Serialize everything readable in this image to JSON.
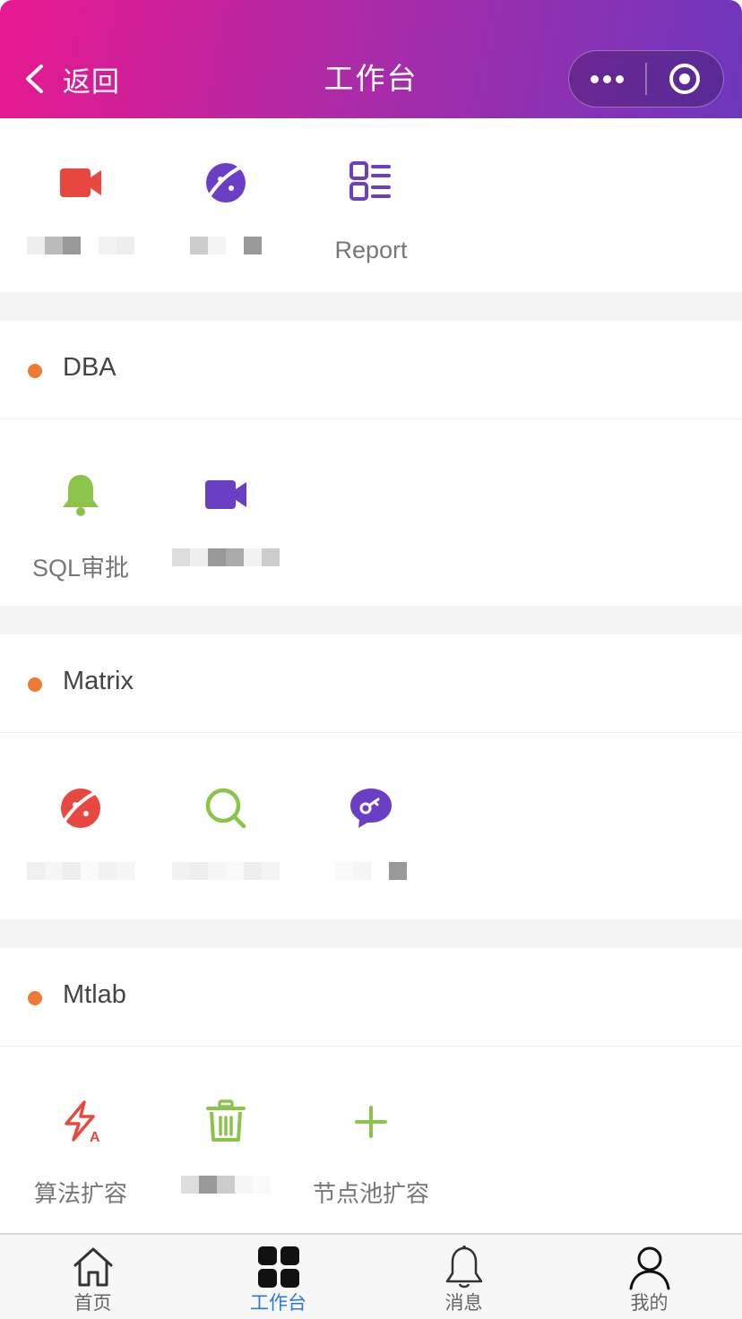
{
  "header": {
    "back_label": "返回",
    "title": "工作台",
    "menu_icon": "more-dots-icon",
    "close_icon": "target-circle-icon",
    "gradient": [
      "#e8188f",
      "#6d37bd"
    ]
  },
  "top_section": {
    "tiles": [
      {
        "icon": "video-camera-icon",
        "label": "",
        "color": "#e8483f"
      },
      {
        "icon": "planet-icon",
        "label": "",
        "color": "#6b3fc5"
      },
      {
        "icon": "report-list-icon",
        "label": "Report",
        "color": "#6b3fc5"
      }
    ]
  },
  "sections": [
    {
      "title": "DBA",
      "tiles": [
        {
          "icon": "bell-icon",
          "label": "SQL审批",
          "color": "#8cc34a"
        },
        {
          "icon": "video-camera-icon",
          "label": "",
          "color": "#6b3fc5"
        }
      ]
    },
    {
      "title": "Matrix",
      "tiles": [
        {
          "icon": "planet-icon",
          "label": "",
          "color": "#e8483f"
        },
        {
          "icon": "search-icon",
          "label": "",
          "color": "#8cc34a"
        },
        {
          "icon": "chat-key-icon",
          "label": "",
          "color": "#6b3fc5"
        }
      ]
    },
    {
      "title": "Mtlab",
      "tiles": [
        {
          "icon": "flash-a-icon",
          "label": "算法扩容",
          "color": "#e8483f"
        },
        {
          "icon": "trash-icon",
          "label": "",
          "color": "#8cc34a"
        },
        {
          "icon": "plus-icon",
          "label": "节点池扩容",
          "color": "#8cc34a"
        }
      ]
    }
  ],
  "tabbar": {
    "tabs": [
      {
        "label": "首页",
        "icon": "home-icon",
        "active": false
      },
      {
        "label": "工作台",
        "icon": "grid-icon",
        "active": true
      },
      {
        "label": "消息",
        "icon": "bell-outline-icon",
        "active": false
      },
      {
        "label": "我的",
        "icon": "person-icon",
        "active": false
      }
    ],
    "active_color": "#2a7ad6"
  },
  "colors": {
    "section_dot": "#ef7a34",
    "separator": "#f4f4f4"
  }
}
